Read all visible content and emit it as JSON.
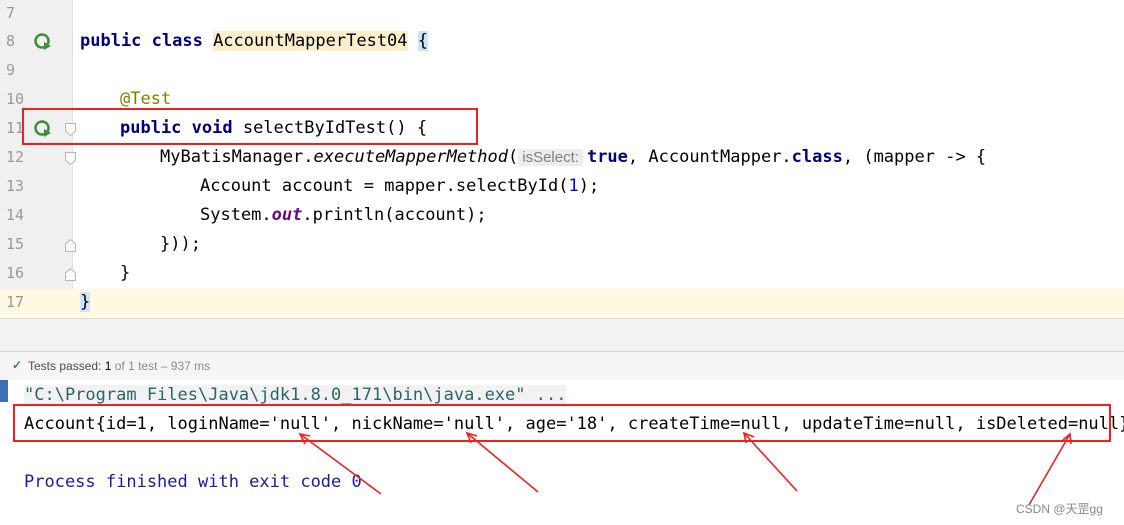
{
  "editor": {
    "lines": [
      {
        "num": "7"
      },
      {
        "num": "8",
        "t1": "public class ",
        "t2": "AccountMapperTest04",
        "t3": " ",
        "t4": "{"
      },
      {
        "num": "9"
      },
      {
        "num": "10",
        "t1": "@Test"
      },
      {
        "num": "11",
        "t1": "public void ",
        "t2": "selectByIdTest() {"
      },
      {
        "num": "12",
        "t1": "MyBatisManager.",
        "t2": "executeMapperMethod",
        "t3": "(",
        "hint": "isSelect:",
        "t4": "true",
        "t5": ", AccountMapper.",
        "t6": "class",
        "t7": ", (mapper -> {"
      },
      {
        "num": "13",
        "t1": "Account account = mapper.selectById(",
        "t2": "1",
        "t3": ");"
      },
      {
        "num": "14",
        "t1": "System.",
        "t2": "out",
        "t3": ".println(account);"
      },
      {
        "num": "15",
        "t1": "}));"
      },
      {
        "num": "16",
        "t1": "}"
      },
      {
        "num": "17",
        "t1": "}"
      }
    ]
  },
  "status": {
    "check": "✓",
    "passed_label": "Tests passed: ",
    "passed_count": "1",
    "of_text": " of 1 test – 937 ms"
  },
  "console": {
    "command": "\"C:\\Program Files\\Java\\jdk1.8.0_171\\bin\\java.exe\" ...",
    "output": "Account{id=1, loginName='null', nickName='null', age='18', createTime=null, updateTime=null, isDeleted=null}",
    "exit_text": "Process finished with exit code 0"
  },
  "watermark": "CSDN @天罡gg",
  "colors": {
    "highlight_box": "#f02020",
    "run_icon": "#3a8f3a"
  }
}
